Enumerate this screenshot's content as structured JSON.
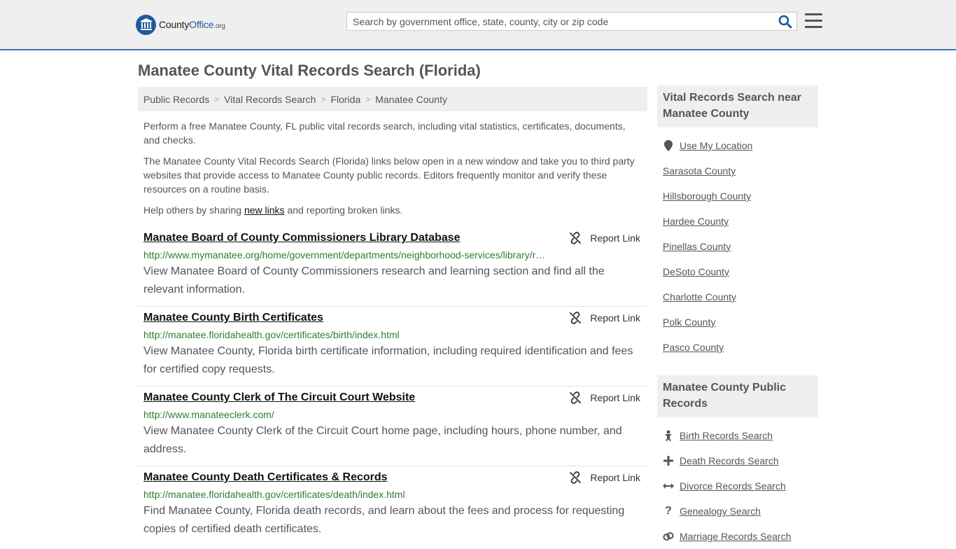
{
  "brand": {
    "name_part1": "County",
    "name_part2": "Office",
    "suffix": ".org"
  },
  "search": {
    "placeholder": "Search by government office, state, county, city or zip code"
  },
  "page": {
    "title": "Manatee County Vital Records Search (Florida)"
  },
  "breadcrumb": [
    {
      "label": "Public Records"
    },
    {
      "label": "Vital Records Search"
    },
    {
      "label": "Florida"
    },
    {
      "label": "Manatee County"
    }
  ],
  "intro": {
    "p1": "Perform a free Manatee County, FL public vital records search, including vital statistics, certificates, documents, and checks.",
    "p2": "The Manatee County Vital Records Search (Florida) links below open in a new window and take you to third party websites that provide access to Manatee County public records. Editors frequently monitor and verify these resources on a routine basis.",
    "p3_pre": "Help others by sharing ",
    "p3_link": "new links",
    "p3_post": " and reporting broken links."
  },
  "report_label": "Report Link",
  "results": [
    {
      "title": "Manatee Board of County Commissioners Library Database",
      "url": "http://www.mymanatee.org/home/government/departments/neighborhood-services/library/r…",
      "desc": "View Manatee Board of County Commissioners research and learning section and find all the relevant information."
    },
    {
      "title": "Manatee County Birth Certificates",
      "url": "http://manatee.floridahealth.gov/certificates/birth/index.html",
      "desc": "View Manatee County, Florida birth certificate information, including required identification and fees for certified copy requests."
    },
    {
      "title": "Manatee County Clerk of The Circuit Court Website",
      "url": "http://www.manateeclerk.com/",
      "desc": "View Manatee County Clerk of the Circuit Court home page, including hours, phone number, and address."
    },
    {
      "title": "Manatee County Death Certificates & Records",
      "url": "http://manatee.floridahealth.gov/certificates/death/index.html",
      "desc": "Find Manatee County, Florida death records, and learn about the fees and process for requesting copies of certified death certificates."
    }
  ],
  "sidebar": {
    "nearby": {
      "heading": "Vital Records Search near Manatee County",
      "use_location": "Use My Location",
      "items": [
        "Sarasota County",
        "Hillsborough County",
        "Hardee County",
        "Pinellas County",
        "DeSoto County",
        "Charlotte County",
        "Polk County",
        "Pasco County"
      ]
    },
    "public_records": {
      "heading": "Manatee County Public Records",
      "items": [
        {
          "label": "Birth Records Search",
          "icon": "baby-icon"
        },
        {
          "label": "Death Records Search",
          "icon": "cross-icon"
        },
        {
          "label": "Divorce Records Search",
          "icon": "arrows-horizontal-icon"
        },
        {
          "label": "Genealogy Search",
          "icon": "question-icon"
        },
        {
          "label": "Marriage Records Search",
          "icon": "rings-icon"
        }
      ]
    }
  },
  "colors": {
    "accent": "#3a78b5",
    "url_green": "#2e7d32",
    "panel_gray": "#efefef"
  }
}
